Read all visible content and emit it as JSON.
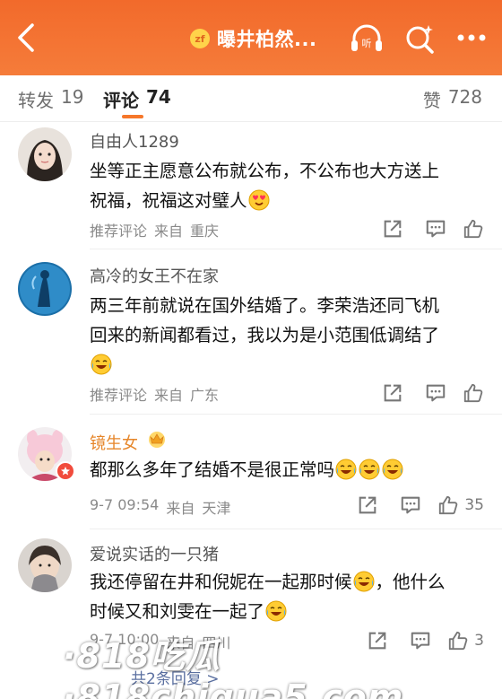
{
  "header": {
    "badge_text": "zf",
    "title": "曝井柏然...",
    "accent_color": "#f26a2b"
  },
  "tabs": {
    "repost": {
      "label": "转发",
      "count": "19"
    },
    "comment": {
      "label": "评论",
      "count": "74"
    },
    "like": {
      "label": "赞",
      "count": "728"
    }
  },
  "comments": [
    {
      "user": "自由人1289",
      "text_lines": [
        "坐等正主愿意公布就公布，不公布也大方送上",
        "祝福，祝福这对璧人"
      ],
      "emoji": "heart-eyes-emoji",
      "tag": "推荐评论",
      "from_label": "来自",
      "location": "重庆"
    },
    {
      "user": "高冷的女王不在家",
      "text_lines": [
        "两三年前就说在国外结婚了。李荣浩还同飞机",
        "回来的新闻都看过，我以为是小范围低调结了"
      ],
      "emoji": "laugh-cry-emoji",
      "tag": "推荐评论",
      "from_label": "来自",
      "location": "广东"
    },
    {
      "user": "镜生女",
      "text_lines": [
        "都那么多年了结婚不是很正常吗"
      ],
      "emoji": "laugh-cry-emoji",
      "time": "9-7 09:54",
      "from_label": "来自",
      "location": "天津",
      "likes": "35"
    },
    {
      "user": "爱说实话的一只猪",
      "text_lines": [
        "我还停留在井和倪妮在一起那时候",
        "，他什么",
        "时候又和刘雯在一起了"
      ],
      "emoji": "laugh-cry-emoji",
      "time": "9-7 10:00",
      "from_label": "来自",
      "location": "四川",
      "likes": "3"
    }
  ],
  "replies_link": "共2条回复 >",
  "watermark": "·818吃瓜·818chigua5.com"
}
